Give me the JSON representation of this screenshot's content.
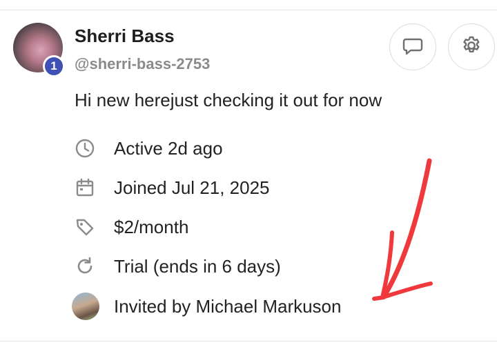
{
  "profile": {
    "name": "Sherri Bass",
    "handle": "@sherri-bass-2753",
    "badge_count": "1",
    "bio": "Hi new herejust checking it out for now"
  },
  "actions": {
    "message_icon": "chat-bubble-icon",
    "settings_icon": "gear-icon"
  },
  "details": {
    "active": "Active 2d ago",
    "joined": "Joined Jul 21, 2025",
    "price": "$2/month",
    "trial": "Trial (ends in 6 days)",
    "invited_by": "Invited by Michael Markuson"
  },
  "colors": {
    "badge": "#3f51b5",
    "annotation_arrow": "#f0393c",
    "icon_gray": "#8a8a8a"
  }
}
